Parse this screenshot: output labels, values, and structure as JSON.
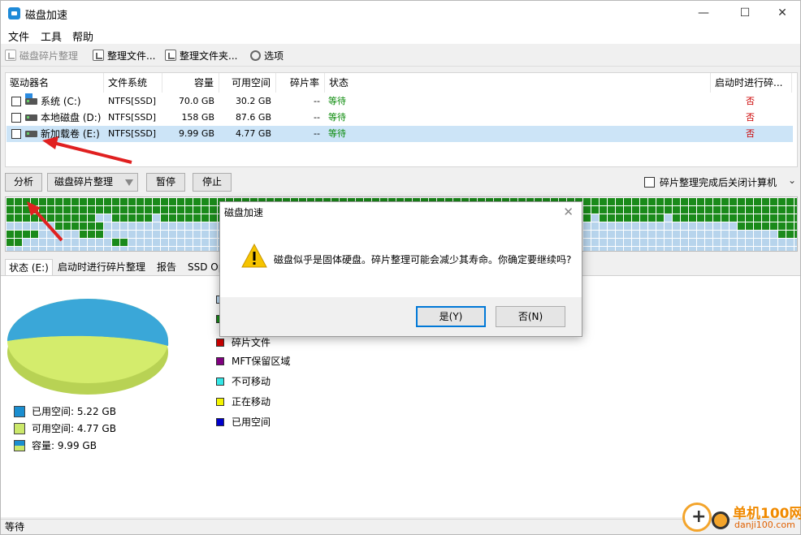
{
  "window": {
    "title": "磁盘加速",
    "minimize": "—",
    "maximize": "☐",
    "close": "✕"
  },
  "menu": [
    "文件",
    "工具",
    "帮助"
  ],
  "toolbar": {
    "defrag": "磁盘碎片整理",
    "defrag_file": "整理文件...",
    "defrag_folder": "整理文件夹...",
    "options": "选项"
  },
  "drives": {
    "headers": {
      "name": "驱动器名",
      "fs": "文件系统",
      "capacity": "容量",
      "free": "可用空间",
      "frag": "碎片率",
      "status": "状态",
      "boot": "启动时进行碎..."
    },
    "rows": [
      {
        "name": "系统 (C:)",
        "fs": "NTFS[SSD]",
        "capacity": "70.0 GB",
        "free": "30.2 GB",
        "frag": "--",
        "status": "等待",
        "boot": "否"
      },
      {
        "name": "本地磁盘 (D:)",
        "fs": "NTFS[SSD]",
        "capacity": "158 GB",
        "free": "87.6 GB",
        "frag": "--",
        "status": "等待",
        "boot": "否"
      },
      {
        "name": "新加载卷 (E:)",
        "fs": "NTFS[SSD]",
        "capacity": "9.99 GB",
        "free": "4.77 GB",
        "frag": "--",
        "status": "等待",
        "boot": "否"
      }
    ]
  },
  "actions": {
    "analyze": "分析",
    "defrag": "磁盘碎片整理",
    "pause": "暂停",
    "stop": "停止",
    "shutdown": "碎片整理完成后关闭计算机"
  },
  "tabs": [
    "状态 (E:)",
    "启动时进行碎片整理",
    "报告",
    "SSD Opt"
  ],
  "legend_left": [
    {
      "label": "已用空间: 5.22 GB",
      "key": "used"
    },
    {
      "label": "可用空间: 4.77 GB",
      "key": "free"
    },
    {
      "label": "容量: 9.99 GB",
      "key": "cap"
    }
  ],
  "legend_right": [
    {
      "label": "碎片文件",
      "color": "#cc0000"
    },
    {
      "label": "MFT保留区域",
      "color": "#800080"
    },
    {
      "label": "不可移动",
      "color": "#33e6e6"
    },
    {
      "label": "正在移动",
      "color": "#f4f400"
    },
    {
      "label": "已用空间",
      "color": "#0000cc"
    }
  ],
  "pie": {
    "used_gb": 5.22,
    "free_gb": 4.77,
    "used_color": "#3aa7d8",
    "free_color": "#d4ec6c"
  },
  "statusbar": "等待",
  "dialog": {
    "title": "磁盘加速",
    "message": "磁盘似乎是固体硬盘。碎片整理可能会减少其寿命。你确定要继续吗?",
    "yes": "是(Y)",
    "no": "否(N)"
  },
  "watermark": {
    "text": "单机100网",
    "sub": "danji100.com"
  }
}
